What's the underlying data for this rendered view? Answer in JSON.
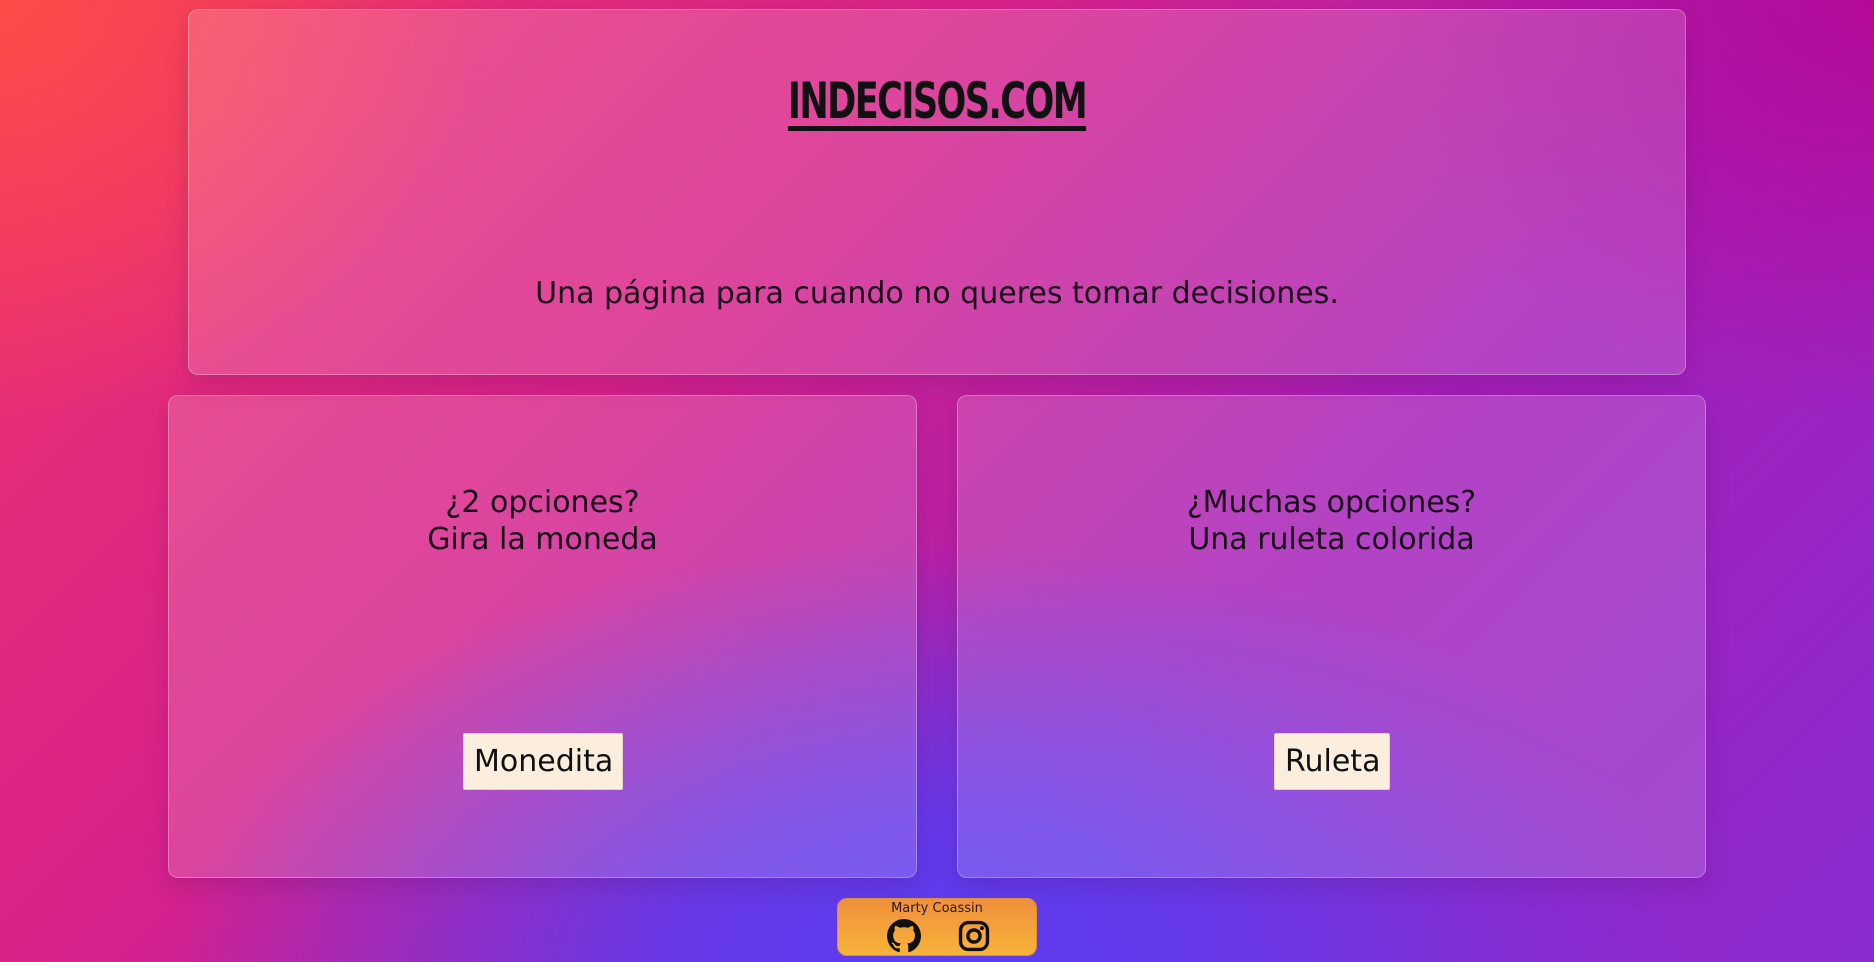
{
  "header": {
    "title": "INDECISOS.COM",
    "tagline": "Una página para cuando no queres tomar decisiones."
  },
  "cards": [
    {
      "line1": "¿2 opciones?",
      "line2": "Gira la moneda",
      "button_label": "Monedita"
    },
    {
      "line1": "¿Muchas opciones?",
      "line2": "Una ruleta colorida",
      "button_label": "Ruleta"
    }
  ],
  "footer": {
    "author": "Marty Coassin",
    "icons": [
      "github-icon",
      "instagram-icon"
    ]
  },
  "colors": {
    "button_bg": "#fbeedc",
    "footer_gradient_top": "#f08f3c",
    "footer_gradient_bottom": "#f7b33a"
  }
}
